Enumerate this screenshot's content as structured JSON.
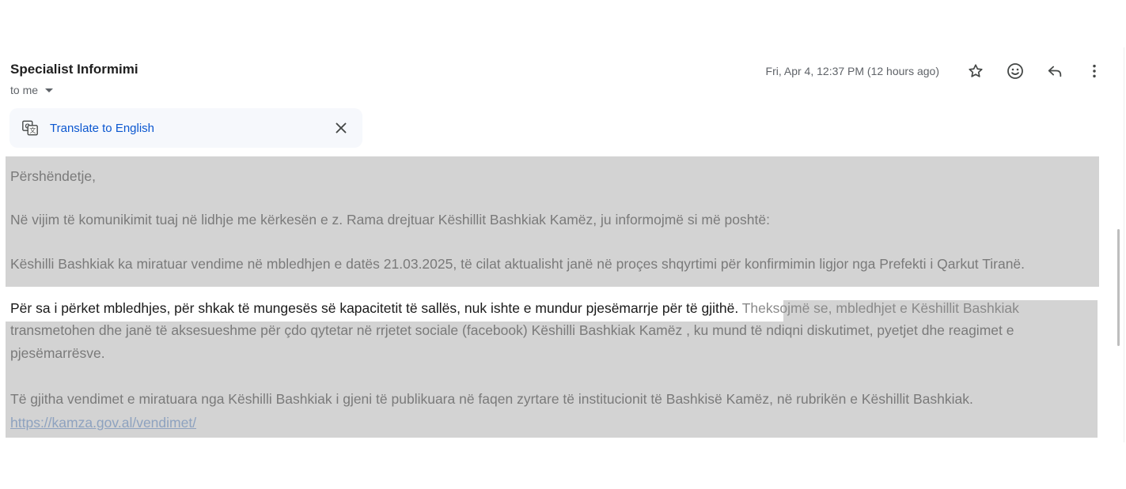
{
  "email": {
    "sender": "Specialist Informimi",
    "recipient_label": "to me",
    "timestamp": "Fri, Apr 4, 12:37 PM (12 hours ago)"
  },
  "actions": {
    "icons": [
      "star-icon",
      "emoji-icon",
      "reply-icon",
      "more-vert-icon"
    ]
  },
  "translate": {
    "label": "Translate to English",
    "icon": "translate-icon"
  },
  "body": {
    "greeting": "Përshëndetje,",
    "paragraph1": "Në vijim të komunikimit tuaj në lidhje me kërkesën e z. Rama drejtuar Këshillit Bashkiak Kamëz, ju informojmë si më poshtë:",
    "paragraph2": "Këshilli Bashkiak ka miratuar vendime në mbledhjen e datës 21.03.2025, të cilat aktualisht janë në proçes shqyrtimi për konfirmimin ligjor nga Prefekti i Qarkut Tiranë.",
    "paragraph3_selected": "Për sa i përket mbledhjes, për shkak të mungesës së kapacitetit të  sallës, nuk ishte e mundur pjesëmarrje për të gjithë.",
    "paragraph3_rest": " Theksojmë se, mbledhjet e Këshillit Bashkiak",
    "paragraph3_line2": "transmetohen dhe janë të aksesueshme për çdo qytetar në rrjetet sociale (facebook) Këshilli Bashkiak Kamëz , ku mund të ndiqni diskutimet, pyetjet dhe reagimet e",
    "paragraph3_line3": "pjesëmarrësve.",
    "paragraph4": "Të gjitha vendimet e miratuara nga Këshilli Bashkiak i gjeni të publikuara në faqen zyrtare të institucionit të Bashkisë Kamëz, në rubrikën e Këshillit Bashkiak.",
    "link": "https://kamza.gov.al/vendimet/"
  },
  "colors": {
    "highlight": "#d3d3d3",
    "link": "#0b57d0",
    "muted_text": "#7a7a7a"
  }
}
